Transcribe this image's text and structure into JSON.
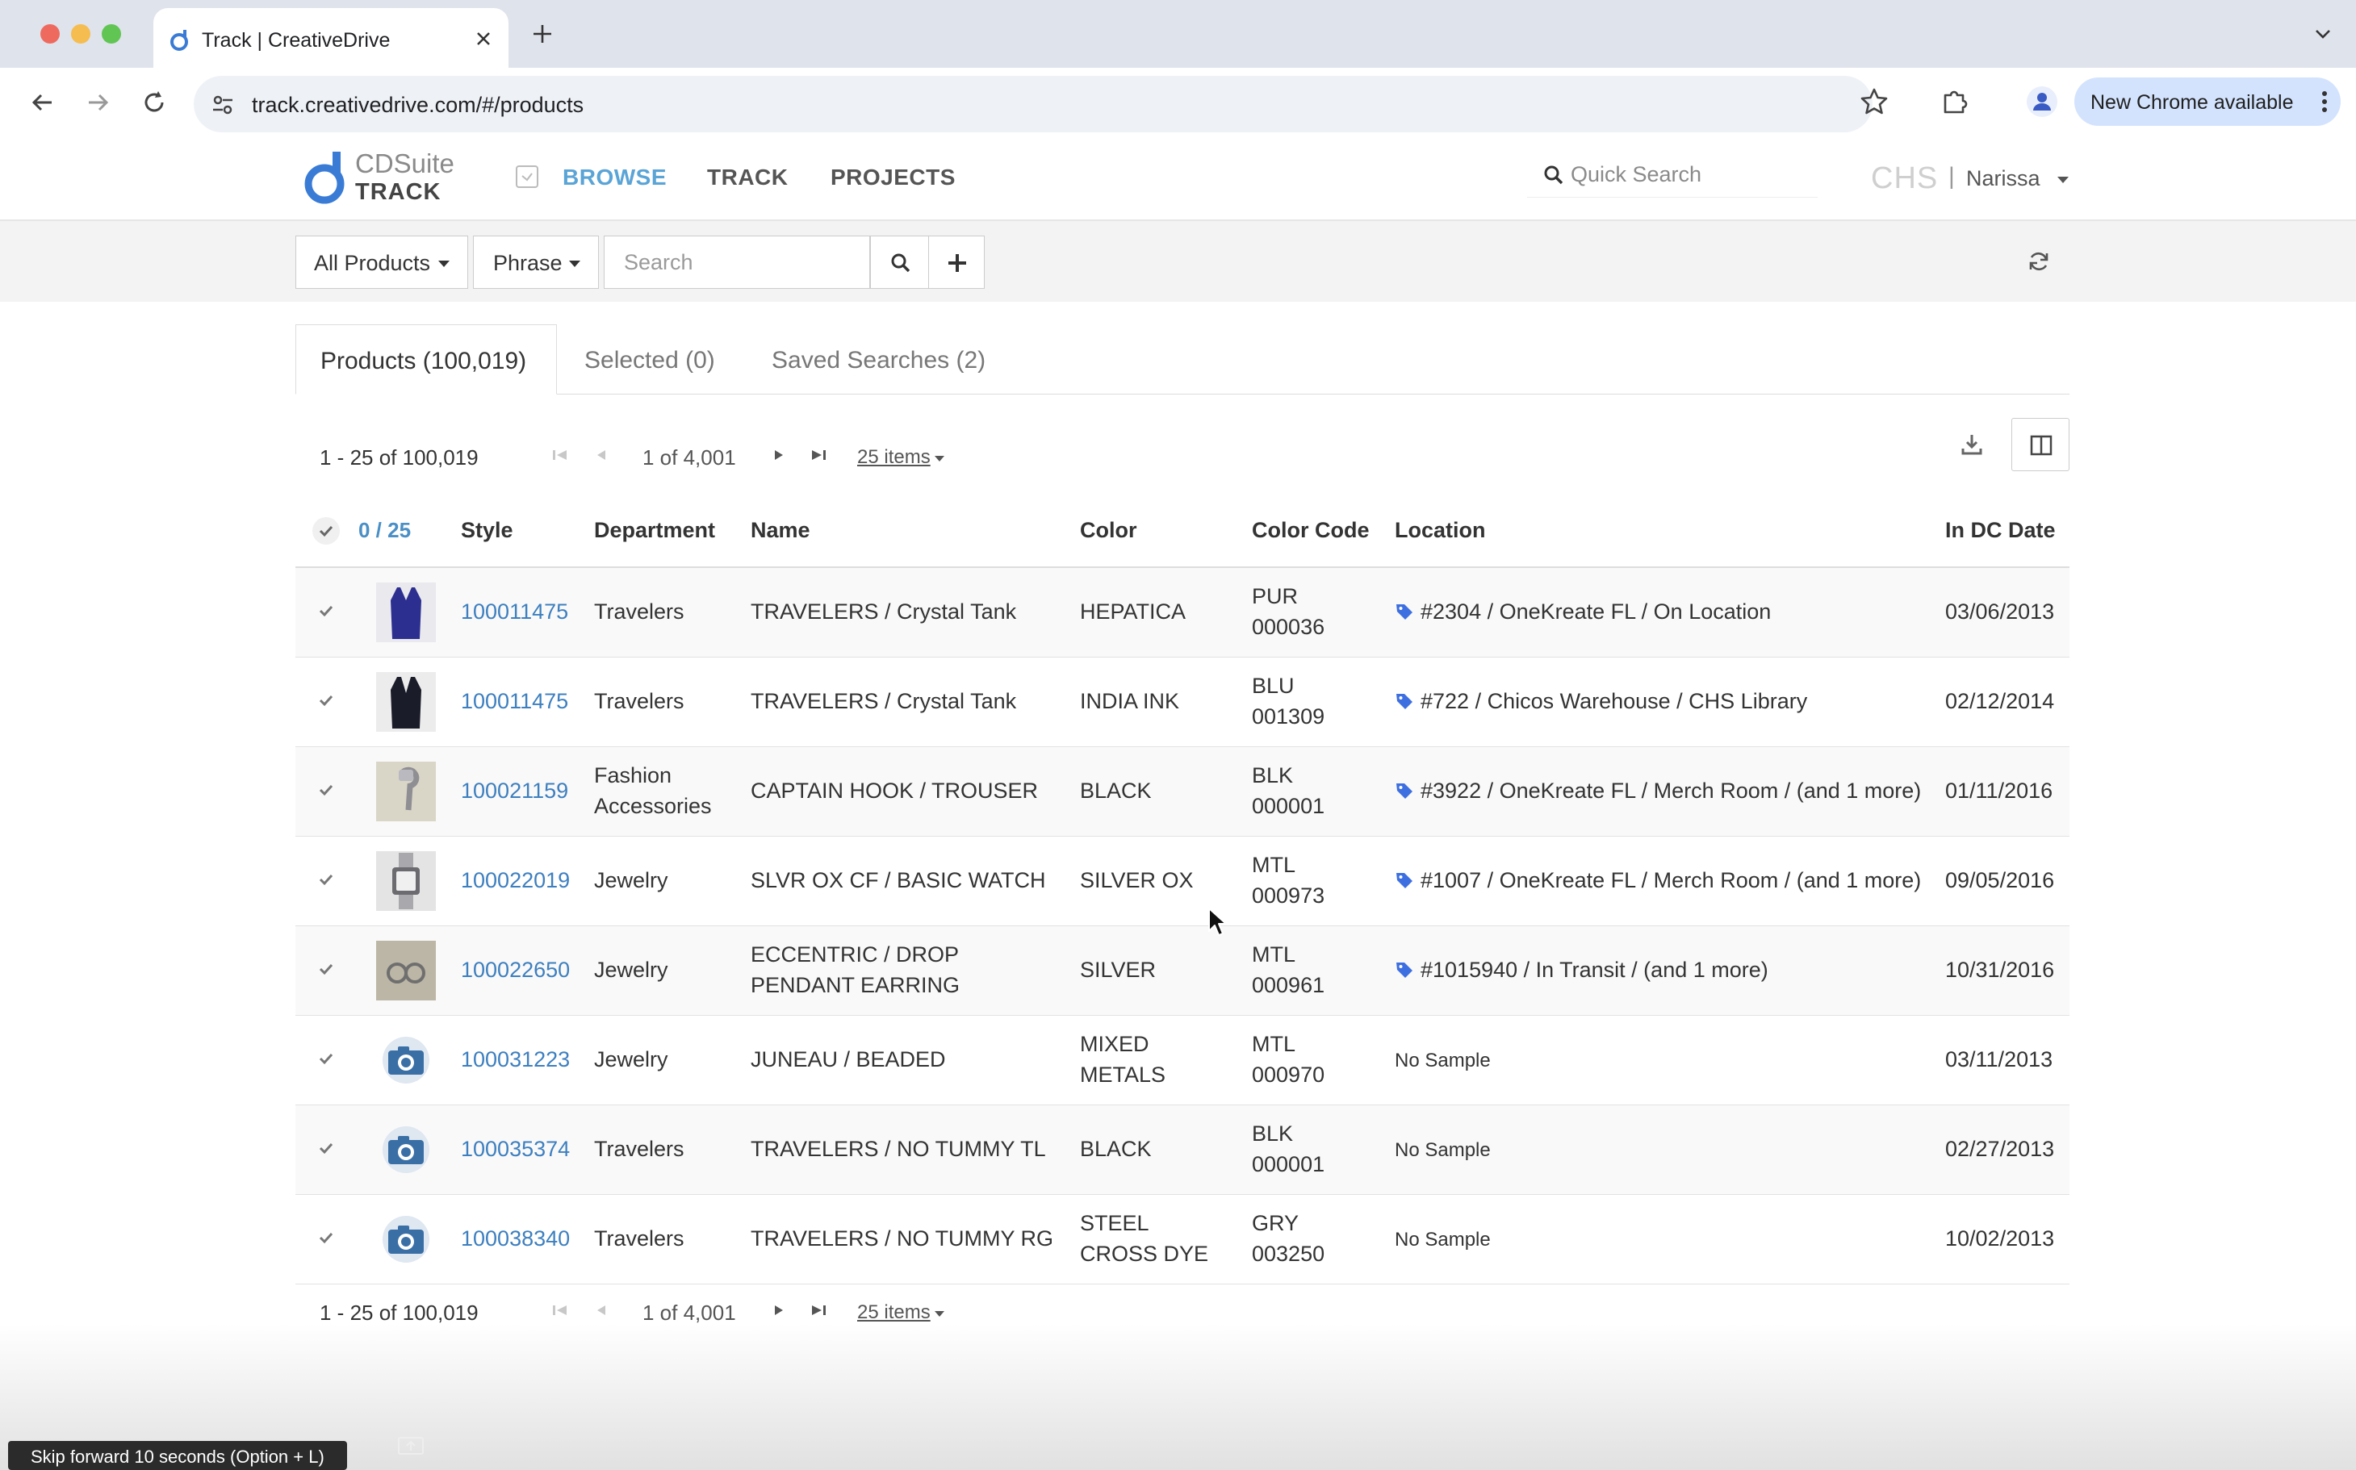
{
  "browser": {
    "tab_title": "Track | CreativeDrive",
    "url": "track.creativedrive.com/#/products",
    "update_button_label": "New Chrome available"
  },
  "app": {
    "logo_line1": "CDSuite",
    "logo_line2": "TRACK",
    "nav": {
      "browse": "BROWSE",
      "track": "TRACK",
      "projects": "PROJECTS"
    },
    "quick_search_placeholder": "Quick Search",
    "company_code": "CHS",
    "divider": "|",
    "user_name": "Narissa"
  },
  "filter_bar": {
    "scope_label": "All Products",
    "mode_label": "Phrase",
    "search_placeholder": "Search",
    "search_value": ""
  },
  "tabs": {
    "products": "Products (100,019)",
    "selected": "Selected (0)",
    "saved_searches": "Saved Searches (2)"
  },
  "pager": {
    "range": "1 - 25 of 100,019",
    "page": "1 of 4,001",
    "page_size": "25 items"
  },
  "table": {
    "selection_count": "0 / 25",
    "columns": {
      "style": "Style",
      "department": "Department",
      "name": "Name",
      "color": "Color",
      "color_code": "Color Code",
      "location": "Location",
      "in_dc_date": "In DC Date"
    },
    "rows": [
      {
        "thumb": "photo-navy-tank",
        "style": "100011475",
        "department": "Travelers",
        "name": "TRAVELERS / Crystal Tank",
        "color": "HEPATICA",
        "code_1": "PUR",
        "code_2": "000036",
        "location": "#2304 / OneKreate FL / On Location",
        "date": "03/06/2013"
      },
      {
        "thumb": "photo-black-tank",
        "style": "100011475",
        "department": "Travelers",
        "name": "TRAVELERS / Crystal Tank",
        "color": "INDIA INK",
        "code_1": "BLU",
        "code_2": "001309",
        "location": "#722 / Chicos Warehouse / CHS Library",
        "date": "02/12/2014"
      },
      {
        "thumb": "photo-hook",
        "style": "100021159",
        "department_1": "Fashion",
        "department_2": "Accessories",
        "name": "CAPTAIN HOOK / TROUSER",
        "color": "BLACK",
        "code_1": "BLK",
        "code_2": "000001",
        "location": "#3922 / OneKreate FL / Merch Room / (and 1 more)",
        "date": "01/11/2016"
      },
      {
        "thumb": "photo-watch",
        "style": "100022019",
        "department": "Jewelry",
        "name": "SLVR OX CF / BASIC WATCH",
        "color": "SILVER OX",
        "code_1": "MTL",
        "code_2": "000973",
        "location": "#1007 / OneKreate FL / Merch Room / (and 1 more)",
        "date": "09/05/2016"
      },
      {
        "thumb": "photo-earring",
        "style": "100022650",
        "department": "Jewelry",
        "name_1": "ECCENTRIC / DROP",
        "name_2": "PENDANT EARRING",
        "color": "SILVER",
        "code_1": "MTL",
        "code_2": "000961",
        "location": "#1015940 / In Transit / (and 1 more)",
        "date": "10/31/2016"
      },
      {
        "thumb": "camera-icon",
        "style": "100031223",
        "department": "Jewelry",
        "name": "JUNEAU / BEADED",
        "color_1": "MIXED",
        "color_2": "METALS",
        "code_1": "MTL",
        "code_2": "000970",
        "location": "No Sample",
        "date": "03/11/2013"
      },
      {
        "thumb": "camera-icon",
        "style": "100035374",
        "department": "Travelers",
        "name": "TRAVELERS / NO TUMMY TL",
        "color": "BLACK",
        "code_1": "BLK",
        "code_2": "000001",
        "location": "No Sample",
        "date": "02/27/2013"
      },
      {
        "thumb": "camera-icon",
        "style": "100038340",
        "department": "Travelers",
        "name": "TRAVELERS / NO TUMMY RG",
        "color_1": "STEEL",
        "color_2": "CROSS DYE",
        "code_1": "GRY",
        "code_2": "003250",
        "location": "No Sample",
        "date": "10/02/2013"
      }
    ]
  },
  "overlay": {
    "tooltip": "Skip forward 10 seconds (Option + L)"
  },
  "colors": {
    "accent_blue": "#5aa4d6",
    "link_blue": "#3d7fbf",
    "tag_blue": "#3d6fe0"
  }
}
